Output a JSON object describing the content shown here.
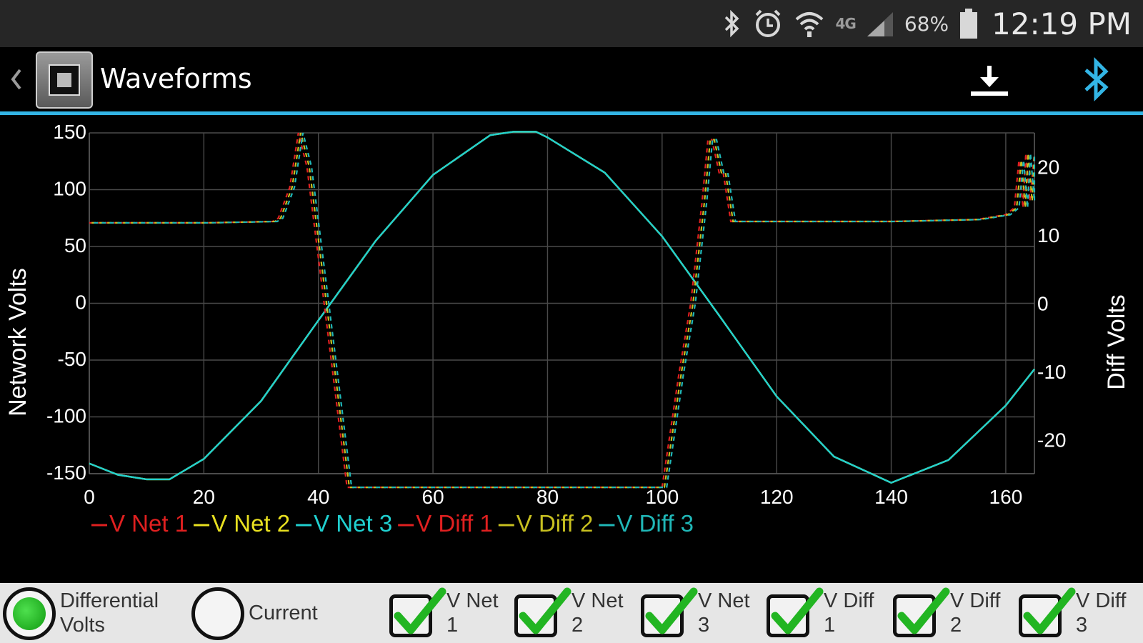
{
  "status_bar": {
    "icons": [
      "bluetooth-icon",
      "alarm-icon",
      "wifi-icon",
      "lte-icon",
      "signal-icon",
      "battery-icon"
    ],
    "network": "4G",
    "battery": "68%",
    "time": "12:19 PM"
  },
  "action_bar": {
    "title": "Waveforms",
    "actions": [
      "download-icon",
      "bluetooth-icon"
    ],
    "accent_color": "#33b5e5"
  },
  "chart_data": {
    "type": "line",
    "ylabel": "Network Volts",
    "y2label": "Diff Volts",
    "xlim": [
      0,
      165
    ],
    "ylim": [
      -150,
      150
    ],
    "y2lim": [
      -25,
      25
    ],
    "xticks": [
      "0",
      "20",
      "40",
      "60",
      "80",
      "100",
      "120",
      "140",
      "160"
    ],
    "yticks": [
      "150",
      "100",
      "50",
      "0",
      "-50",
      "-100",
      "-150"
    ],
    "y2ticks": [
      "20",
      "10",
      "0",
      "-10",
      "-20"
    ],
    "grid": true,
    "legend_position": "bottom-left",
    "series": [
      {
        "name": "V Net 1",
        "color": "#e02020",
        "axis": "left",
        "style": "solid",
        "shift": 0,
        "x": [
          0,
          5,
          10,
          14,
          20,
          30,
          40,
          50,
          60,
          70,
          74,
          78,
          80,
          90,
          100,
          110,
          120,
          130,
          140,
          150,
          160,
          165
        ],
        "y": [
          -141,
          -151,
          -155,
          -155,
          -137,
          -86,
          -15,
          55,
          113,
          148,
          151,
          151,
          146,
          115,
          59,
          -11,
          -82,
          -135,
          -158,
          -138,
          -90,
          -58
        ]
      },
      {
        "name": "V Net 2",
        "color": "#e8e020",
        "axis": "left",
        "style": "solid",
        "shift": 0,
        "x": [
          0,
          5,
          10,
          14,
          20,
          30,
          40,
          50,
          60,
          70,
          74,
          78,
          80,
          90,
          100,
          110,
          120,
          130,
          140,
          150,
          160,
          165
        ],
        "y": [
          -141,
          -151,
          -155,
          -155,
          -137,
          -86,
          -15,
          55,
          113,
          148,
          151,
          151,
          146,
          115,
          59,
          -11,
          -82,
          -135,
          -158,
          -138,
          -90,
          -58
        ]
      },
      {
        "name": "V Net 3",
        "color": "#20d0d0",
        "axis": "left",
        "style": "solid",
        "shift": 0,
        "x": [
          0,
          5,
          10,
          14,
          20,
          30,
          40,
          50,
          60,
          70,
          74,
          78,
          80,
          90,
          100,
          110,
          120,
          130,
          140,
          150,
          160,
          165
        ],
        "y": [
          -141,
          -151,
          -155,
          -155,
          -137,
          -86,
          -15,
          55,
          113,
          148,
          151,
          151,
          146,
          115,
          59,
          -11,
          -82,
          -135,
          -158,
          -138,
          -90,
          -58
        ]
      },
      {
        "name": "V Diff 1",
        "color": "#e02020",
        "axis": "right",
        "style": "dashed",
        "shift": 0,
        "x": [
          0,
          20,
          32,
          33,
          35,
          36.5,
          38,
          41,
          45,
          48,
          60,
          75,
          100,
          103,
          105,
          107,
          108,
          108.7,
          110,
          110.7,
          112,
          140,
          155,
          160,
          161.5,
          162.3,
          163,
          163.5,
          164.2,
          165
        ],
        "y": [
          11.8,
          11.8,
          12,
          12.5,
          17,
          25,
          20,
          0,
          -27,
          -27,
          -27,
          -27,
          -27,
          -10,
          0,
          15,
          24,
          24,
          19,
          19,
          12,
          12,
          12.3,
          13,
          14,
          21,
          14,
          22,
          15,
          22
        ]
      },
      {
        "name": "V Diff 2",
        "color": "#c8c020",
        "axis": "right",
        "style": "dashed",
        "shift": 0.4,
        "x": [
          0,
          20,
          32,
          33,
          35,
          36.5,
          38,
          41,
          45,
          48,
          60,
          75,
          100,
          103,
          105,
          107,
          108,
          108.7,
          110,
          110.7,
          112,
          140,
          155,
          160,
          161.5,
          162.3,
          163,
          163.5,
          164.2,
          165
        ],
        "y": [
          11.8,
          11.8,
          12,
          12.5,
          17,
          25,
          20,
          0,
          -27,
          -27,
          -27,
          -27,
          -27,
          -10,
          0,
          15,
          24,
          24,
          19,
          19,
          12,
          12,
          12.3,
          13,
          14,
          21,
          14,
          22,
          15,
          22
        ]
      },
      {
        "name": "V Diff 3",
        "color": "#20b8b8",
        "axis": "right",
        "style": "dashed",
        "shift": 0.8,
        "x": [
          0,
          20,
          32,
          33,
          35,
          36.5,
          38,
          41,
          45,
          48,
          60,
          75,
          100,
          103,
          105,
          107,
          108,
          108.7,
          110,
          110.7,
          112,
          140,
          155,
          160,
          161.5,
          162.3,
          163,
          163.5,
          164.2,
          165
        ],
        "y": [
          11.8,
          11.8,
          12,
          12.5,
          17,
          25,
          20,
          0,
          -27,
          -27,
          -27,
          -27,
          -27,
          -10,
          0,
          15,
          24,
          24,
          19,
          19,
          12,
          12,
          12.3,
          13,
          14,
          21,
          14,
          22,
          15,
          22
        ]
      }
    ]
  },
  "controls": {
    "radios": [
      {
        "name": "radio-differential-volts",
        "line1": "Differential",
        "line2": "Volts",
        "selected": true
      },
      {
        "name": "radio-current",
        "line1": "Current",
        "line2": "",
        "selected": false
      }
    ],
    "checkboxes": [
      {
        "name": "checkbox-v-net-1",
        "line1": "V Net",
        "line2": "1",
        "checked": true
      },
      {
        "name": "checkbox-v-net-2",
        "line1": "V Net",
        "line2": "2",
        "checked": true
      },
      {
        "name": "checkbox-v-net-3",
        "line1": "V Net",
        "line2": "3",
        "checked": true
      },
      {
        "name": "checkbox-v-diff-1",
        "line1": "V Diff",
        "line2": "1",
        "checked": true
      },
      {
        "name": "checkbox-v-diff-2",
        "line1": "V Diff",
        "line2": "2",
        "checked": true
      },
      {
        "name": "checkbox-v-diff-3",
        "line1": "V Diff",
        "line2": "3",
        "checked": true
      }
    ]
  }
}
